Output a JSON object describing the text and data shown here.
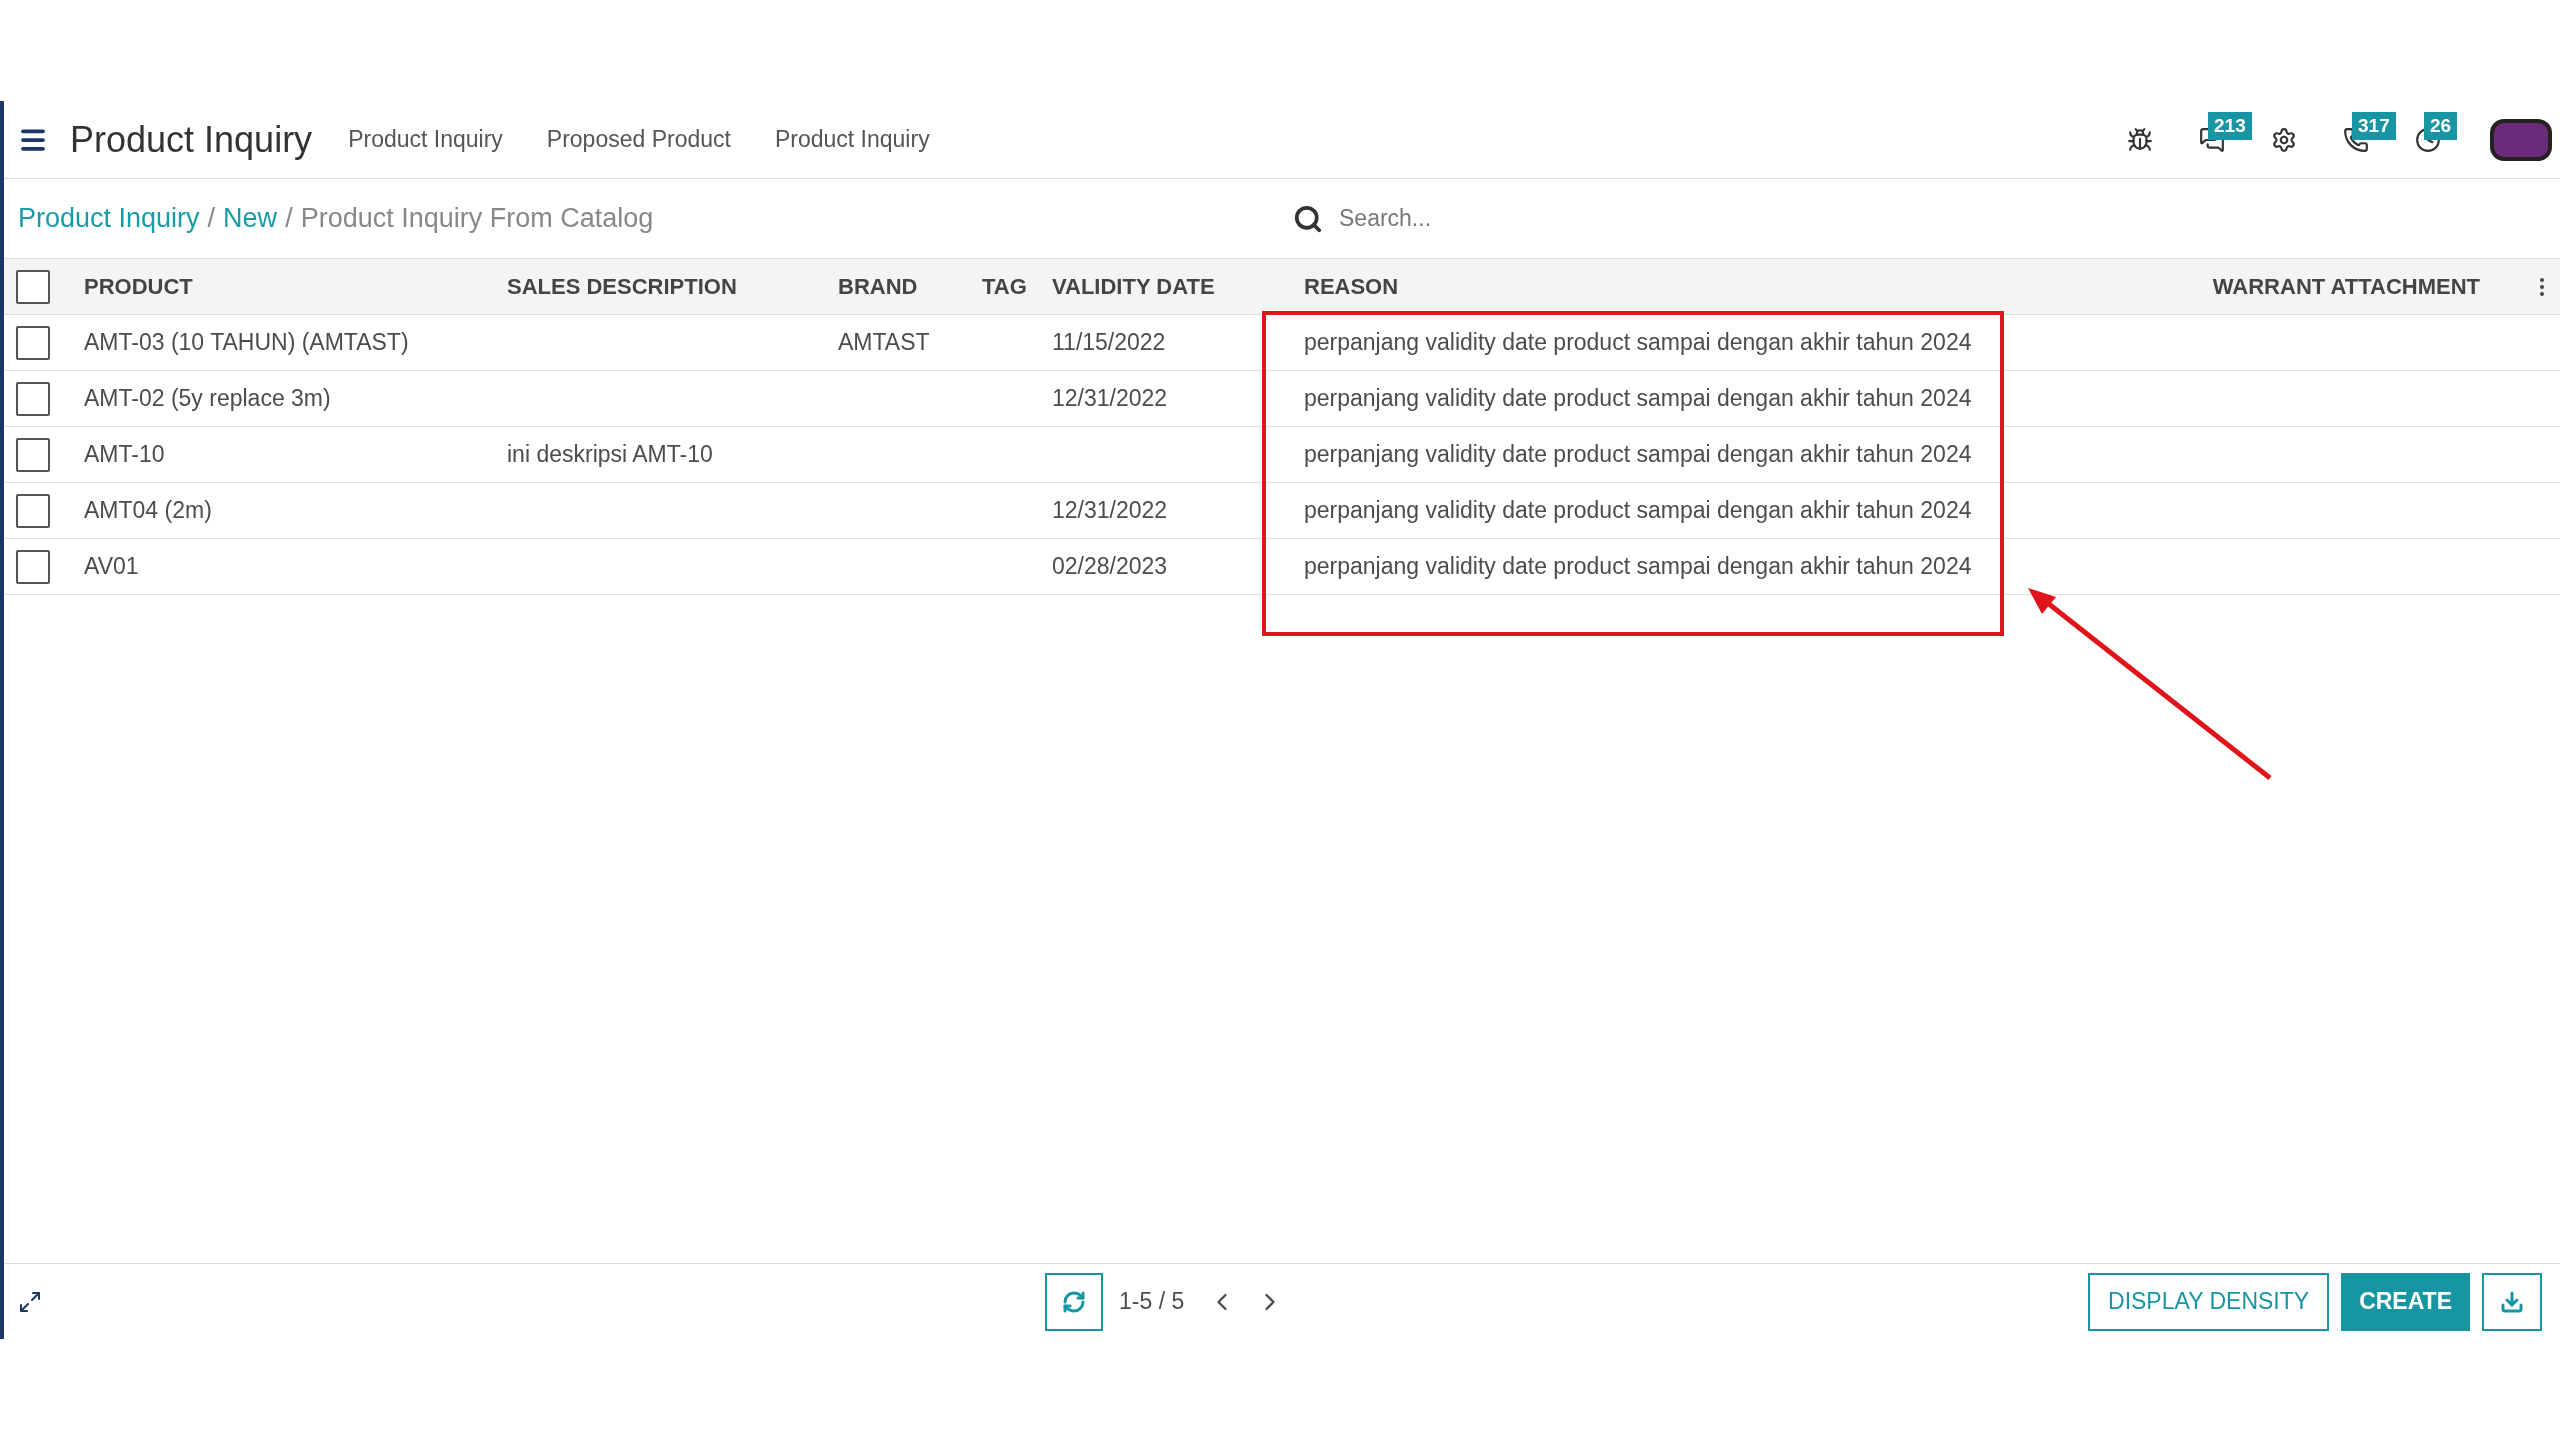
{
  "app_title": "Product Inquiry",
  "menu": [
    "Product Inquiry",
    "Proposed Product",
    "Product Inquiry"
  ],
  "systray": [
    {
      "kind": "bug"
    },
    {
      "kind": "chat",
      "badge": "213"
    },
    {
      "kind": "gear"
    },
    {
      "kind": "phone",
      "badge": "317"
    },
    {
      "kind": "clock",
      "badge": "26"
    },
    {
      "kind": "avatar"
    }
  ],
  "breadcrumb_separator": "/",
  "breadcrumb": [
    {
      "label": "Product Inquiry",
      "kind": "link"
    },
    {
      "label": "New",
      "kind": "link"
    },
    {
      "label": "Product Inquiry From Catalog",
      "kind": "current"
    }
  ],
  "search": {
    "placeholder": "Search..."
  },
  "table": {
    "select_all": {
      "checked": false
    },
    "columns": [
      "PRODUCT",
      "SALES DESCRIPTION",
      "BRAND",
      "TAG",
      "VALIDITY DATE",
      "REASON",
      "WARRANT ATTACHMENT"
    ],
    "rows": [
      {
        "selected": false,
        "cells": [
          "AMT-03 (10 TAHUN) (AMTAST)",
          "",
          "AMTAST",
          "",
          "11/15/2022",
          "perpanjang validity date product sampai dengan akhir tahun 2024",
          ""
        ]
      },
      {
        "selected": false,
        "cells": [
          "AMT-02 (5y replace 3m)",
          "",
          "",
          "",
          "12/31/2022",
          "perpanjang validity date product sampai dengan akhir tahun 2024",
          ""
        ]
      },
      {
        "selected": false,
        "cells": [
          "AMT-10",
          "ini deskripsi AMT-10",
          "",
          "",
          "",
          "perpanjang validity date product sampai dengan akhir tahun 2024",
          ""
        ]
      },
      {
        "selected": false,
        "cells": [
          "AMT04 (2m)",
          "",
          "",
          "",
          "12/31/2022",
          "perpanjang validity date product sampai dengan akhir tahun 2024",
          ""
        ]
      },
      {
        "selected": false,
        "cells": [
          "AV01",
          "",
          "",
          "",
          "02/28/2023",
          "perpanjang validity date product sampai dengan akhir tahun 2024",
          ""
        ]
      }
    ]
  },
  "pager": "1-5 / 5",
  "buttons": [
    {
      "label": "DISPLAY DENSITY",
      "kind": "outline"
    },
    {
      "label": "CREATE",
      "kind": "primary"
    },
    {
      "kind": "download"
    }
  ]
}
